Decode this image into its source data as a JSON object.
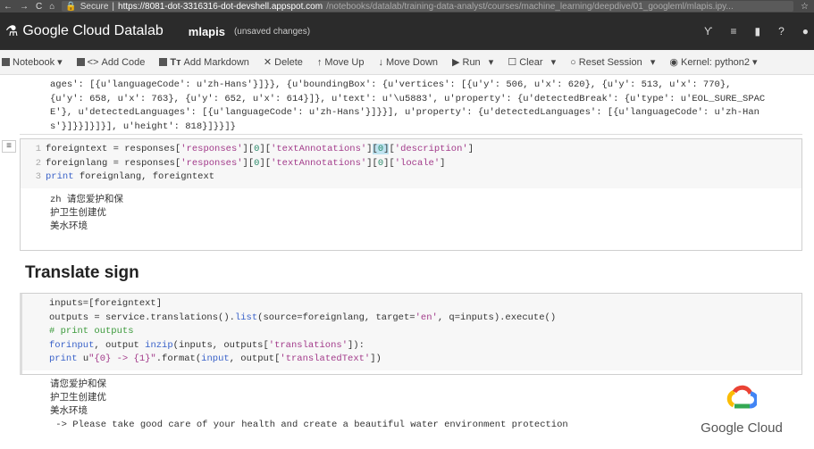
{
  "browser": {
    "secure": "Secure",
    "url_host": "https://8081-dot-3316316-dot-devshell.appspot.com",
    "url_path": "/notebooks/datalab/training-data-analyst/courses/machine_learning/deepdive/01_googleml/mlapis.ipy..."
  },
  "app": {
    "title": "Google Cloud Datalab",
    "notebook": "mlapis",
    "status": "(unsaved changes)"
  },
  "toolbar": {
    "notebook": "Notebook",
    "add_code": "Add Code",
    "add_markdown": "Add Markdown",
    "delete": "Delete",
    "move_up": "Move Up",
    "move_down": "Move Down",
    "run": "Run",
    "clear": "Clear",
    "reset": "Reset Session",
    "kernel": "Kernel: python2"
  },
  "prev_output": [
    "ages': [{u'languageCode': u'zh-Hans'}]}}, {u'boundingBox': {u'vertices': [{u'y': 506, u'x': 620}, {u'y': 513, u'x': 770},",
    "{u'y': 658, u'x': 763}, {u'y': 652, u'x': 614}]}, u'text': u'\\u5883', u'property': {u'detectedBreak': {u'type': u'EOL_SURE_SPAC",
    "E'}, u'detectedLanguages': [{u'languageCode': u'zh-Hans'}]}}], u'property': {u'detectedLanguages': [{u'languageCode': u'zh-Han",
    "s'}]}}]}]}], u'height': 818}]}}]}"
  ],
  "cell1": {
    "output": [
      "zh 请您爱护和保",
      "护卫生创建优",
      "美水环境"
    ]
  },
  "heading": "Translate sign",
  "cell2": {
    "output": [
      "请您爱护和保",
      "护卫生创建优",
      "美水环境",
      " -> Please take good care of your health and create a beautiful water environment protection"
    ]
  },
  "brand": "Google Cloud"
}
